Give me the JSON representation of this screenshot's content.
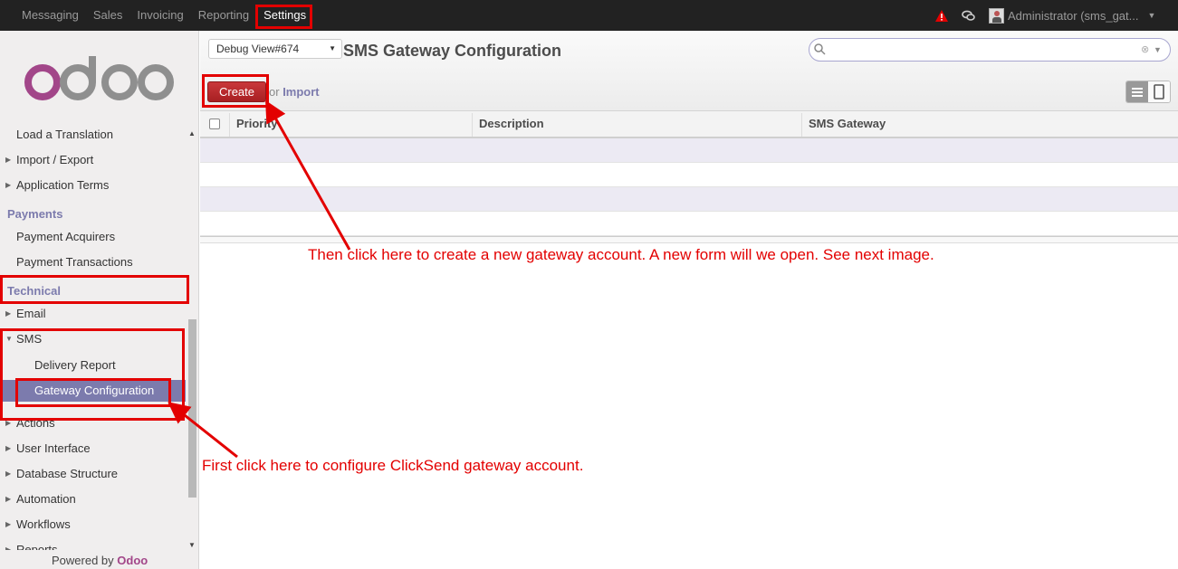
{
  "topbar": {
    "menu": [
      "Messaging",
      "Sales",
      "Invoicing",
      "Reporting",
      "Settings"
    ],
    "active": "Settings",
    "user": "Administrator (sms_gat..."
  },
  "sidebar": {
    "logo": "odoo",
    "items": {
      "load_translation": "Load a Translation",
      "import_export": "Import / Export",
      "application_terms": "Application Terms",
      "payments_header": "Payments",
      "payment_acquirers": "Payment Acquirers",
      "payment_transactions": "Payment Transactions",
      "technical_header": "Technical",
      "email": "Email",
      "sms": "SMS",
      "delivery_report": "Delivery Report",
      "gateway_configuration": "Gateway Configuration",
      "actions": "Actions",
      "user_interface": "User Interface",
      "database_structure": "Database Structure",
      "automation": "Automation",
      "workflows": "Workflows",
      "reports": "Reports"
    },
    "powered_by": "Powered by",
    "powered_brand": "Odoo"
  },
  "header": {
    "debug_select": "Debug View#674",
    "title": "SMS Gateway Configuration",
    "search_value": "",
    "create_label": "Create",
    "or_label": "or",
    "import_label": "Import"
  },
  "table": {
    "columns": [
      "Priority",
      "Description",
      "SMS Gateway"
    ]
  },
  "annotations": {
    "top": "Then click here to create a new gateway account. A new form will we open. See next image.",
    "bottom": "First click here to configure ClickSend gateway account."
  },
  "colors": {
    "topbar": "#222222",
    "accent": "#7c7bad",
    "create_button": "#b52a2d",
    "annotation": "#e30000"
  }
}
